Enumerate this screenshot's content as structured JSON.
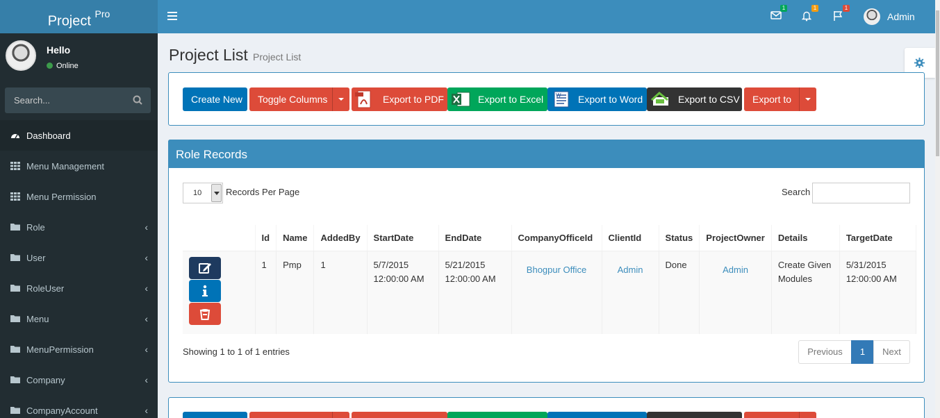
{
  "brand": {
    "name": "Project",
    "suffix": "Pro"
  },
  "user_panel": {
    "greeting": "Hello",
    "status": "Online"
  },
  "sidebar_search": {
    "placeholder": "Search..."
  },
  "sidebar": {
    "items": [
      {
        "label": "Dashboard",
        "icon": "dashboard-icon",
        "active": true
      },
      {
        "label": "Menu Management",
        "icon": "grid-icon"
      },
      {
        "label": "Menu Permission",
        "icon": "grid-icon"
      },
      {
        "label": "Role",
        "icon": "folder-icon",
        "expandable": true
      },
      {
        "label": "User",
        "icon": "folder-icon",
        "expandable": true
      },
      {
        "label": "RoleUser",
        "icon": "folder-icon",
        "expandable": true
      },
      {
        "label": "Menu",
        "icon": "folder-icon",
        "expandable": true
      },
      {
        "label": "MenuPermission",
        "icon": "folder-icon",
        "expandable": true
      },
      {
        "label": "Company",
        "icon": "folder-icon",
        "expandable": true
      },
      {
        "label": "CompanyAccount",
        "icon": "folder-icon",
        "expandable": true
      }
    ]
  },
  "header": {
    "mail_count": "1",
    "bell_count": "1",
    "flag_count": "1",
    "user_name": "Admin"
  },
  "page": {
    "title": "Project List",
    "subtitle": "Project List"
  },
  "toolbar": {
    "create": "Create New",
    "toggle": "Toggle Columns",
    "pdf": "Export to PDF",
    "excel": "Export to Excel",
    "word": "Export to Word",
    "csv": "Export to CSV",
    "export_to": "Export to"
  },
  "panel": {
    "title": "Role Records",
    "page_size": "10",
    "page_size_label": "Records Per Page",
    "search_label": "Search"
  },
  "table": {
    "columns": [
      "",
      "Id",
      "Name",
      "AddedBy",
      "StartDate",
      "EndDate",
      "CompanyOfficeId",
      "ClientId",
      "Status",
      "ProjectOwner",
      "Details",
      "TargetDate"
    ],
    "row": {
      "id": "1",
      "name": "Pmp",
      "added_by": "1",
      "start_date": "5/7/2015 12:00:00 AM",
      "end_date": "5/21/2015 12:00:00 AM",
      "company_office": "Bhogpur Office",
      "client": "Admin",
      "status": "Done",
      "project_owner": "Admin",
      "details": "Create Given Modules",
      "target_date": "5/31/2015 12:00:00 AM"
    }
  },
  "footer": {
    "showing": "Showing 1 to 1 of 1 entries",
    "prev": "Previous",
    "page": "1",
    "next": "Next"
  },
  "colors": {
    "header": "#3c8dbc",
    "sidebar": "#222d32",
    "primary": "#0073b7",
    "danger": "#dd4b39",
    "success": "#00a65a",
    "dark": "#333333"
  }
}
